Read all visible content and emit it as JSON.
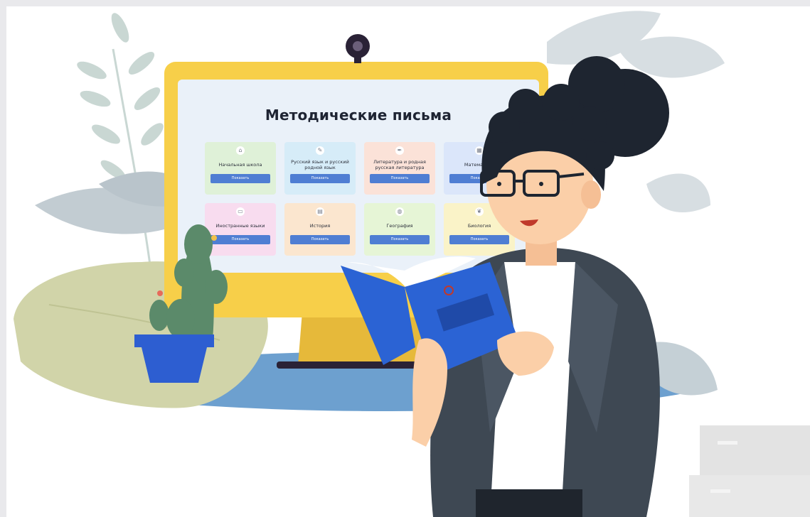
{
  "screen": {
    "title": "Методические письма",
    "cards": [
      {
        "label": "Начальная школа",
        "button": "Показать",
        "color": "#dff1d8",
        "icon": "house-icon"
      },
      {
        "label": "Русский язык и русский родной язык",
        "button": "Показать",
        "color": "#d6ecf8",
        "icon": "pen-icon"
      },
      {
        "label": "Литература и родная русская литература",
        "button": "Показать",
        "color": "#fbe2d8",
        "icon": "feather-icon"
      },
      {
        "label": "Математика",
        "button": "Показать",
        "color": "#dbe6fa",
        "icon": "calculator-icon"
      },
      {
        "label": "Иностранные языки",
        "button": "Показать",
        "color": "#f8dcef",
        "icon": "chat-icon"
      },
      {
        "label": "История",
        "button": "Показать",
        "color": "#fbe6cf",
        "icon": "scroll-icon"
      },
      {
        "label": "География",
        "button": "Показать",
        "color": "#e6f5d6",
        "icon": "globe-icon"
      },
      {
        "label": "Биология",
        "button": "Показать",
        "color": "#faf3c8",
        "icon": "leaf-icon"
      }
    ]
  },
  "colors": {
    "monitor_frame": "#f7cf49",
    "monitor_stand": "#e6b93a",
    "book": "#2b63d4",
    "jacket": "#3e4853",
    "hair": "#1e2530",
    "skin": "#fbcfa8",
    "pot": "#2d5ed1",
    "cactus": "#5b8a6a",
    "floor_shadow": "#6da0cf"
  }
}
